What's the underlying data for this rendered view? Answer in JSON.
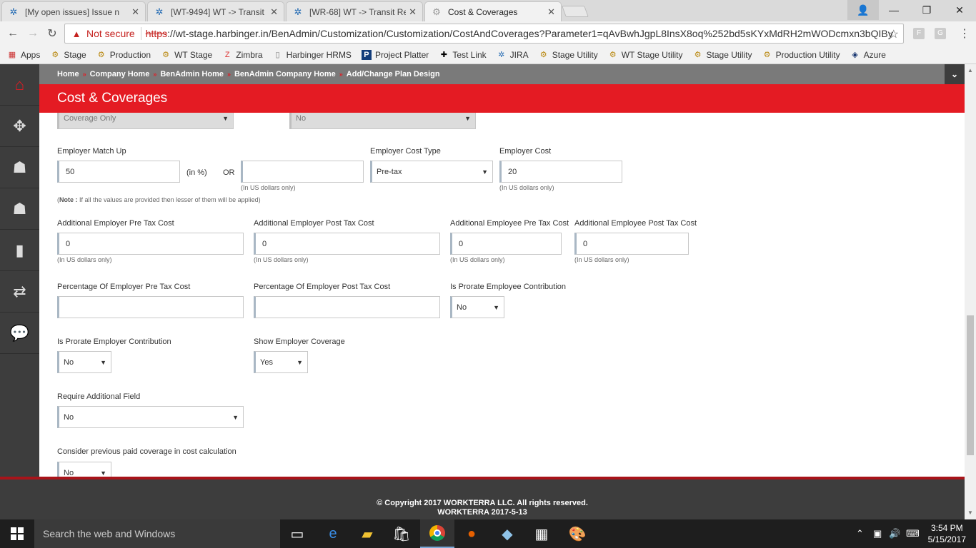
{
  "browser": {
    "tabs": [
      {
        "title": "[My open issues] Issue n",
        "icon": "jira-icon"
      },
      {
        "title": "[WT-9494] WT -> Transit",
        "icon": "jira-icon"
      },
      {
        "title": "[WR-68] WT -> Transit Re",
        "icon": "jira-icon"
      },
      {
        "title": "Cost & Coverages",
        "icon": "gear-icon"
      }
    ],
    "not_secure": "Not secure",
    "url_scheme": "https",
    "url_rest": "://wt-stage.harbinger.in/BenAdmin/Customization/Customization/CostAndCoverages?Parameter1=qAvBwhJgpL8InsX8oq%252bd5sKYxMdRH2mWODcmxn3bQIBy",
    "bookmarks": [
      "Apps",
      "Stage",
      "Production",
      "WT Stage",
      "Zimbra",
      "Harbinger HRMS",
      "Project Platter",
      "Test Link",
      "JIRA",
      "Stage Utility",
      "WT Stage Utility",
      "Stage Utility",
      "Production Utility",
      "Azure"
    ]
  },
  "breadcrumb": [
    "Home",
    "Company Home",
    "BenAdmin Home",
    "BenAdmin Company Home",
    "Add/Change Plan Design"
  ],
  "page_title": "Cost & Coverages",
  "form": {
    "top_select_1": "Coverage Only",
    "top_select_2": "No",
    "employer_match_up": {
      "label": "Employer Match Up",
      "value": "50",
      "unit": "(in %)",
      "or": "OR",
      "dollar_value": "",
      "dollar_hint": "(In US dollars only)"
    },
    "employer_cost_type": {
      "label": "Employer Cost Type",
      "value": "Pre-tax"
    },
    "employer_cost": {
      "label": "Employer Cost",
      "value": "20",
      "hint": "(In US dollars only)"
    },
    "note_label": "Note :",
    "note_text": " If all the values are provided then lesser of them will be applied)",
    "note_open": "(",
    "add_er_pre": {
      "label": "Additional Employer Pre Tax Cost",
      "value": "0",
      "hint": "(In US dollars only)"
    },
    "add_er_post": {
      "label": "Additional Employer Post Tax Cost",
      "value": "0",
      "hint": "(In US dollars only)"
    },
    "add_ee_pre": {
      "label": "Additional Employee Pre Tax Cost",
      "value": "0",
      "hint": "(In US dollars only)"
    },
    "add_ee_post": {
      "label": "Additional Employee Post Tax Cost",
      "value": "0",
      "hint": "(In US dollars only)"
    },
    "pct_er_pre": {
      "label": "Percentage Of Employer Pre Tax Cost",
      "value": ""
    },
    "pct_er_post": {
      "label": "Percentage Of Employer Post Tax Cost",
      "value": ""
    },
    "prorate_ee": {
      "label": "Is Prorate Employee Contribution",
      "value": "No"
    },
    "prorate_er": {
      "label": "Is Prorate Employer Contribution",
      "value": "No"
    },
    "show_er_cov": {
      "label": "Show Employer Coverage",
      "value": "Yes"
    },
    "require_add": {
      "label": "Require Additional Field",
      "value": "No"
    },
    "consider_prev": {
      "label": "Consider previous paid coverage in cost calculation",
      "value": "No"
    }
  },
  "footer": {
    "copyright": "© Copyright 2017 WORKTERRA LLC. All rights reserved.",
    "version": "WORKTERRA 2017-5-13"
  },
  "taskbar": {
    "search_placeholder": "Search the web and Windows",
    "time": "3:54 PM",
    "date": "5/15/2017"
  },
  "colors": {
    "brand_red": "#e41b23",
    "sidebar": "#3d3d3d",
    "breadcrumb_bg": "#7a7a7a"
  }
}
